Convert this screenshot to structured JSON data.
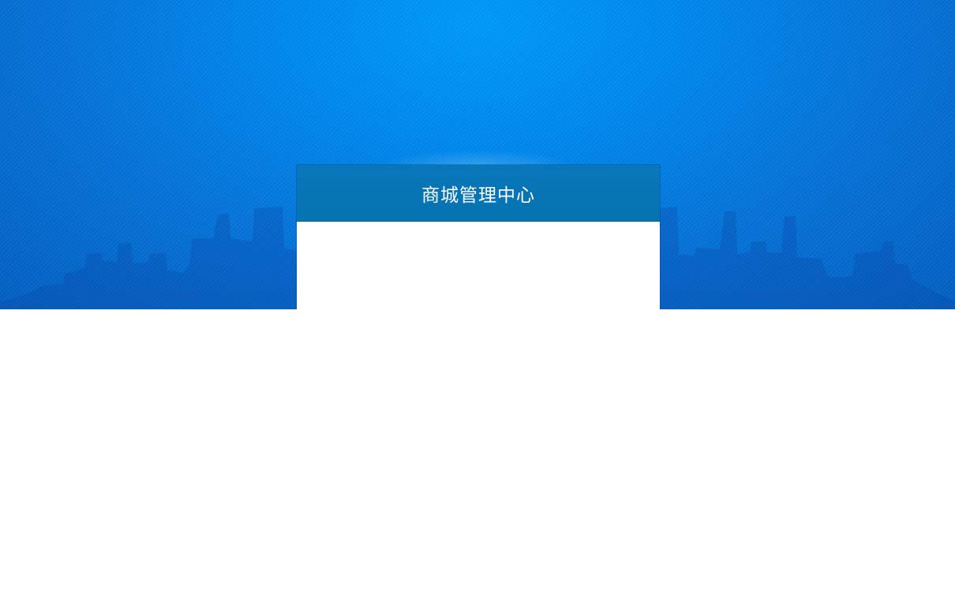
{
  "login_panel": {
    "title": "商城管理中心"
  },
  "colors": {
    "background_blue": "#0088ec",
    "panel_header_blue": "#0877b9",
    "panel_body": "#ffffff",
    "title_text": "#ffffff"
  },
  "icons": {
    "background_decoration": "city-skyline"
  }
}
